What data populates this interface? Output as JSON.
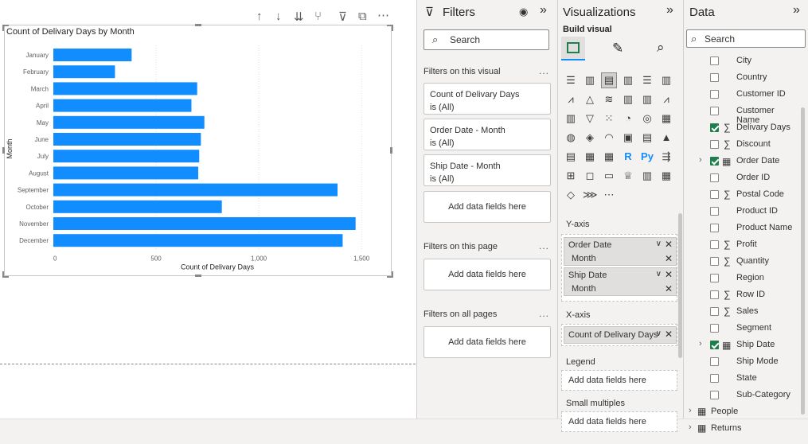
{
  "canvas": {
    "visual_toolbar": [
      "arrow-up-icon",
      "arrow-down-icon",
      "double-arrow-down-icon",
      "fork-icon",
      "filter-icon",
      "focus-icon",
      "more-icon"
    ],
    "chart_title": "Count of Delivary Days by Month"
  },
  "chart_data": {
    "type": "bar",
    "orientation": "horizontal",
    "title": "Count of Delivary Days by Month",
    "xlabel": "Count of Delivary Days",
    "ylabel": "Month",
    "categories": [
      "January",
      "February",
      "March",
      "April",
      "May",
      "June",
      "July",
      "August",
      "September",
      "October",
      "November",
      "December"
    ],
    "values": [
      381,
      300,
      700,
      672,
      735,
      718,
      710,
      705,
      1383,
      820,
      1471,
      1408
    ],
    "xlim": [
      0,
      1600
    ],
    "xticks": [
      "0",
      "500",
      "1,000",
      "1,500"
    ],
    "grid": true,
    "bar_color": "#118dff"
  },
  "filters": {
    "title": "Filters",
    "search_placeholder": "Search",
    "on_visual_label": "Filters on this visual",
    "cards": [
      {
        "name": "Count of Delivary Days",
        "state": "is (All)"
      },
      {
        "name": "Order Date - Month",
        "state": "is (All)"
      },
      {
        "name": "Ship Date - Month",
        "state": "is (All)"
      }
    ],
    "add_fields": "Add data fields here",
    "on_page_label": "Filters on this page",
    "on_all_pages_label": "Filters on all pages",
    "more": "..."
  },
  "viz": {
    "title": "Visualizations",
    "build_visual": "Build visual",
    "icons_row1": [
      "stacked-bar-icon",
      "stacked-column-icon",
      "clustered-bar-icon",
      "clustered-column-icon",
      "100-bar-icon",
      "100-column-icon"
    ],
    "y_axis_label": "Y-axis",
    "y_fields": [
      {
        "table": "Order Date",
        "field": "Month"
      },
      {
        "table": "Ship Date",
        "field": "Month"
      }
    ],
    "x_axis_label": "X-axis",
    "x_field": "Count of Delivary Days",
    "legend_label": "Legend",
    "small_multiples_label": "Small multiples",
    "add_fields": "Add data fields here",
    "r_glyph": "R",
    "py_glyph": "Py"
  },
  "data": {
    "title": "Data",
    "search_placeholder": "Search",
    "fields": [
      {
        "name": "City",
        "checked": false,
        "type": "text"
      },
      {
        "name": "Country",
        "checked": false,
        "type": "text"
      },
      {
        "name": "Customer ID",
        "checked": false,
        "type": "text"
      },
      {
        "name": "Customer Name",
        "checked": false,
        "type": "text"
      },
      {
        "name": "Delivary Days",
        "checked": true,
        "type": "sum"
      },
      {
        "name": "Discount",
        "checked": false,
        "type": "sum"
      },
      {
        "name": "Order Date",
        "checked": true,
        "type": "date"
      },
      {
        "name": "Order ID",
        "checked": false,
        "type": "text"
      },
      {
        "name": "Postal Code",
        "checked": false,
        "type": "sum"
      },
      {
        "name": "Product ID",
        "checked": false,
        "type": "text"
      },
      {
        "name": "Product Name",
        "checked": false,
        "type": "text"
      },
      {
        "name": "Profit",
        "checked": false,
        "type": "sum"
      },
      {
        "name": "Quantity",
        "checked": false,
        "type": "sum"
      },
      {
        "name": "Region",
        "checked": false,
        "type": "text"
      },
      {
        "name": "Row ID",
        "checked": false,
        "type": "sum"
      },
      {
        "name": "Sales",
        "checked": false,
        "type": "sum"
      },
      {
        "name": "Segment",
        "checked": false,
        "type": "text"
      },
      {
        "name": "Ship Date",
        "checked": true,
        "type": "date"
      },
      {
        "name": "Ship Mode",
        "checked": false,
        "type": "text"
      },
      {
        "name": "State",
        "checked": false,
        "type": "text"
      },
      {
        "name": "Sub-Category",
        "checked": false,
        "type": "text"
      }
    ],
    "tables": [
      "People",
      "Returns"
    ]
  }
}
